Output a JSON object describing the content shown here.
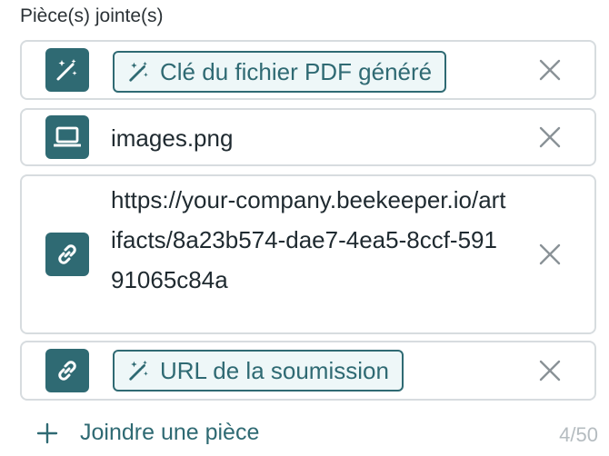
{
  "section_title": "Pièce(s) jointe(s)",
  "attachments": [
    {
      "type": "variable",
      "icon": "magic-wand-icon",
      "label": "Clé du fichier PDF généré"
    },
    {
      "type": "file",
      "icon": "computer-icon",
      "label": "images.png"
    },
    {
      "type": "link",
      "icon": "link-icon",
      "label": "https://your-company.beekeeper.io/artifacts/8a23b574-dae7-4ea5-8ccf-59191065c84a"
    },
    {
      "type": "variable-link",
      "icon": "link-icon",
      "label": "URL de la soumission"
    }
  ],
  "footer": {
    "add_label": "Joindre une pièce",
    "counter": "4/50"
  },
  "colors": {
    "accent": "#2f6a73",
    "chip_bg": "#eef7f8",
    "border": "#d7dcdf",
    "muted": "#b5bcc0"
  }
}
